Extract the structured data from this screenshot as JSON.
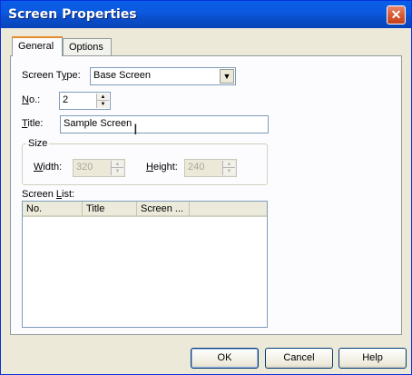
{
  "window": {
    "title": "Screen Properties",
    "close_glyph": "✕"
  },
  "tabs": [
    {
      "label": "General",
      "active": true
    },
    {
      "label": "Options",
      "active": false
    }
  ],
  "screen_type": {
    "label_pre": "Screen T",
    "label_u": "y",
    "label_post": "pe:",
    "value": "Base Screen"
  },
  "number": {
    "label_u": "N",
    "label_post": "o.:",
    "value": "2"
  },
  "title_field": {
    "label_u": "T",
    "label_post": "itle:",
    "value": "Sample Screen"
  },
  "size": {
    "legend": "Size",
    "width_label_u": "W",
    "width_label_post": "idth:",
    "width_value": "320",
    "height_label_u": "H",
    "height_label_post": "eight:",
    "height_value": "240"
  },
  "screen_list": {
    "label_pre": "Screen ",
    "label_u": "L",
    "label_post": "ist:",
    "columns": [
      "No.",
      "Title",
      "Screen ..."
    ]
  },
  "buttons": {
    "ok": "OK",
    "cancel": "Cancel",
    "help": "Help"
  },
  "icons": {
    "dropdown": "dropdown-arrow-icon",
    "close": "close-icon",
    "spin_up": "spin-up-icon",
    "spin_down": "spin-down-icon",
    "cursor": "text-cursor-icon"
  },
  "colors": {
    "titlebar": "#0a5ee8",
    "window_bg": "#ece9d8",
    "close": "#d8572f",
    "tab_highlight": "#e68b2c"
  }
}
